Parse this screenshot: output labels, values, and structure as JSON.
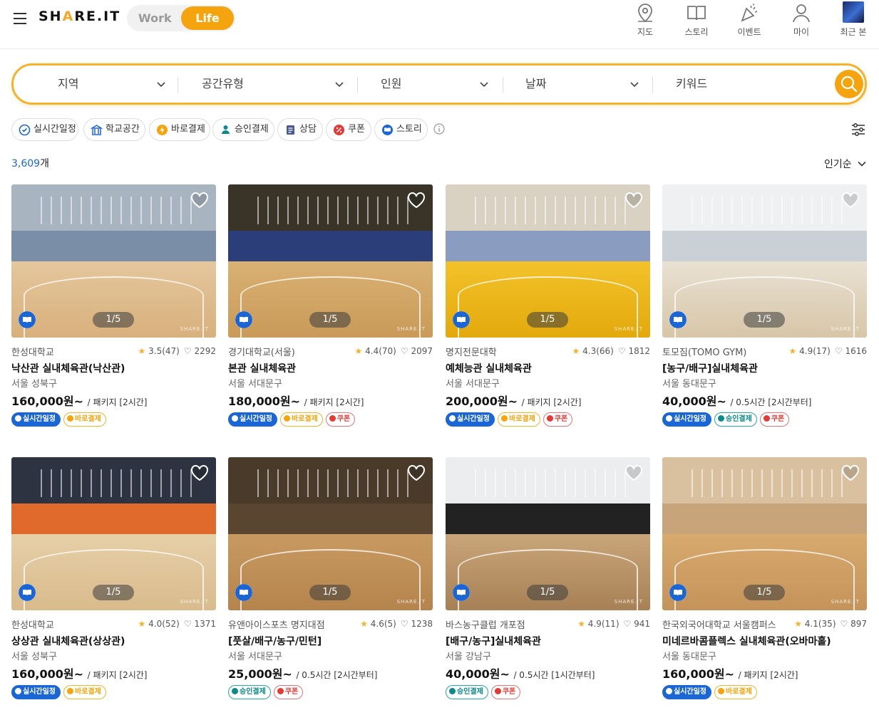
{
  "header": {
    "brand": "SHARE.IT",
    "mode_work": "Work",
    "mode_life": "Life",
    "nav": [
      {
        "label": "지도",
        "icon": "map-pin-icon"
      },
      {
        "label": "스토리",
        "icon": "book-icon"
      },
      {
        "label": "이벤트",
        "icon": "party-icon"
      },
      {
        "label": "마이",
        "icon": "user-icon"
      },
      {
        "label": "최근 본",
        "icon": "recent-thumbnail"
      }
    ]
  },
  "search": {
    "region": "지역",
    "space_type": "공간유형",
    "people": "인원",
    "date": "날짜",
    "keyword": "키워드"
  },
  "filters": [
    "실시간일정",
    "학교공간",
    "바로결제",
    "승인결제",
    "상담",
    "쿠폰",
    "스토리"
  ],
  "results": {
    "count": "3,609",
    "count_unit": "개",
    "sort": "인기순"
  },
  "colors": {
    "accent": "#f6a40e",
    "realtime": "#1a66d6",
    "coupon": "#e53935",
    "approval": "#0a8a8a"
  },
  "cards": [
    {
      "vendor": "한성대학교",
      "rating": "3.5(47)",
      "likes": "2292",
      "title": "낙산관 실내체육관(낙산관)",
      "location": "서울 성북구",
      "price": "160,000원~",
      "unit": "/ 패키지 [2시간]",
      "pager": "1/5",
      "watermark": "SHARE.IT",
      "tags": [
        {
          "label": "실시간일정",
          "type": "rt"
        },
        {
          "label": "바로결제",
          "type": "pay"
        }
      ]
    },
    {
      "vendor": "경기대학교(서울)",
      "rating": "4.4(70)",
      "likes": "2097",
      "title": "본관 실내체육관",
      "location": "서울 서대문구",
      "price": "180,000원~",
      "unit": "/ 패키지 [2시간]",
      "pager": "1/5",
      "watermark": "SHARE.IT",
      "tags": [
        {
          "label": "실시간일정",
          "type": "rt"
        },
        {
          "label": "바로결제",
          "type": "pay"
        },
        {
          "label": "쿠폰",
          "type": "cp"
        }
      ]
    },
    {
      "vendor": "명지전문대학",
      "rating": "4.3(66)",
      "likes": "1812",
      "title": "예체능관 실내체육관",
      "location": "서울 서대문구",
      "price": "200,000원~",
      "unit": "/ 패키지 [2시간]",
      "pager": "1/5",
      "watermark": "SHARE.IT",
      "tags": [
        {
          "label": "실시간일정",
          "type": "rt"
        },
        {
          "label": "바로결제",
          "type": "pay"
        },
        {
          "label": "쿠폰",
          "type": "cp"
        }
      ]
    },
    {
      "vendor": "토모짐(TOMO GYM)",
      "rating": "4.9(17)",
      "likes": "1616",
      "title": "[농구/배구]실내체육관",
      "location": "서울 동대문구",
      "price": "40,000원~",
      "unit": "/ 0.5시간 [2시간부터]",
      "pager": "1/5",
      "watermark": "SHARE.IT",
      "tags": [
        {
          "label": "실시간일정",
          "type": "rt"
        },
        {
          "label": "승인결제",
          "type": "ap"
        },
        {
          "label": "쿠폰",
          "type": "cp"
        }
      ]
    },
    {
      "vendor": "한성대학교",
      "rating": "4.0(52)",
      "likes": "1371",
      "title": "상상관 실내체육관(상상관)",
      "location": "서울 성북구",
      "price": "160,000원~",
      "unit": "/ 패키지 [2시간]",
      "pager": "1/5",
      "watermark": "SHARE.IT",
      "tags": [
        {
          "label": "실시간일정",
          "type": "rt"
        },
        {
          "label": "바로결제",
          "type": "pay"
        }
      ]
    },
    {
      "vendor": "유앤아이스포츠 명지대점",
      "rating": "4.6(5)",
      "likes": "1238",
      "title": "[풋살/배구/농구/민턴]",
      "location": "서울 서대문구",
      "price": "25,000원~",
      "unit": "/ 0.5시간 [2시간부터]",
      "pager": "1/5",
      "watermark": "SHARE.IT",
      "tags": [
        {
          "label": "승인결제",
          "type": "ap"
        },
        {
          "label": "쿠폰",
          "type": "cp"
        }
      ]
    },
    {
      "vendor": "바스농구클럽 개포점",
      "rating": "4.9(11)",
      "likes": "941",
      "title": "[배구/농구]실내체육관",
      "location": "서울 강남구",
      "price": "40,000원~",
      "unit": "/ 0.5시간 [1시간부터]",
      "pager": "1/5",
      "watermark": "SHARE.IT",
      "tags": [
        {
          "label": "승인결제",
          "type": "ap"
        },
        {
          "label": "쿠폰",
          "type": "cp"
        }
      ]
    },
    {
      "vendor": "한국외국어대학교 서울캠퍼스",
      "rating": "4.1(35)",
      "likes": "897",
      "title": "미네르바콤플렉스 실내체육관(오바마홀)",
      "location": "서울 동대문구",
      "price": "160,000원~",
      "unit": "/ 패키지 [2시간]",
      "pager": "1/5",
      "watermark": "SHARE.IT",
      "tags": [
        {
          "label": "실시간일정",
          "type": "rt"
        },
        {
          "label": "바로결제",
          "type": "pay"
        }
      ]
    }
  ]
}
